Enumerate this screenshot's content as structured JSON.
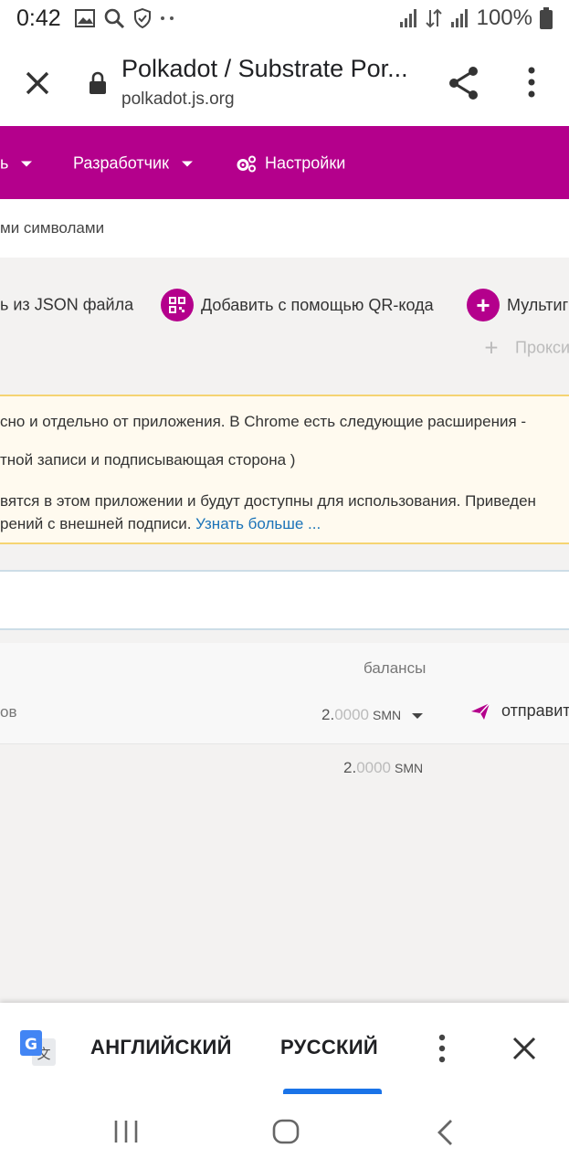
{
  "status_bar": {
    "time": "0:42",
    "battery": "100%"
  },
  "toolbar": {
    "title": "Polkadot / Substrate Por...",
    "domain": "polkadot.js.org"
  },
  "nav": {
    "items": [
      {
        "label": "ь"
      },
      {
        "label": "Разработчик"
      },
      {
        "label": "Настройки"
      }
    ]
  },
  "subheader": {
    "text": "ми символами"
  },
  "actions": {
    "json_label": "ь из JSON файла",
    "qr_label": "Добавить с помощью QR-кода",
    "multisig_label": "Мультиг",
    "proxy_label": "Прокси"
  },
  "warning": {
    "line1": "сно и отдельно от приложения. В Chrome есть следующие расширения -",
    "line2": "тной записи и подписывающая сторона )",
    "line3": "вятся в этом приложении и будут доступны для использования. Приведен",
    "line4": "рений с внешней подписи.",
    "learn_more": "Узнать больше ..."
  },
  "table": {
    "header_balances": "балансы",
    "row_label": "ов",
    "balance_int": "2.",
    "balance_dec": "0000",
    "balance_unit": "SMN",
    "send_label": "отправит",
    "sub_balance_int": "2.",
    "sub_balance_dec": "0000",
    "sub_balance_unit": "SMN"
  },
  "translate_bar": {
    "lang_from": "АНГЛИЙСКИЙ",
    "lang_to": "РУССКИЙ",
    "selected": "РУССКИЙ"
  },
  "colors": {
    "brand": "#b4008c",
    "link": "#1a73b8",
    "translate_accent": "#1a73e8"
  }
}
